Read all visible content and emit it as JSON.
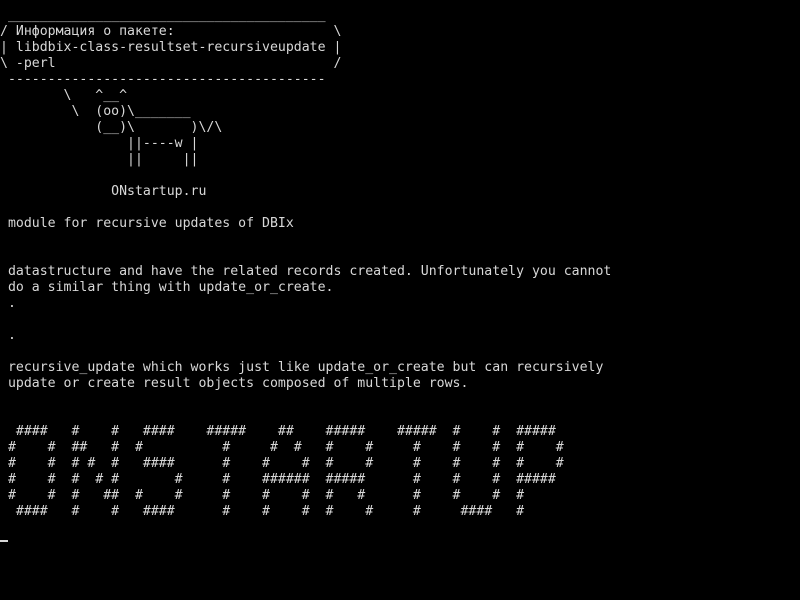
{
  "terminal": {
    "lines": [
      " ________________________________________",
      "/ Информация о пакете:                    \\",
      "| libdbix-class-resultset-recursiveupdate |",
      "\\ -perl                                   /",
      " ----------------------------------------",
      "        \\   ^__^",
      "         \\  (oo)\\_______",
      "            (__)\\       )\\/\\",
      "                ||----w |",
      "                ||     ||",
      "",
      "              ONstartup.ru",
      "",
      " module for recursive updates of DBIx",
      "",
      "",
      " datastructure and have the related records created. Unfortunately you cannot",
      " do a similar thing with update_or_create.",
      " .",
      "",
      " .",
      "",
      " recursive_update which works just like update_or_create but can recursively",
      " update or create result objects composed of multiple rows.",
      "",
      "",
      "  ####   #    #   ####    #####    ##    #####    #####  #    #  #####",
      " #    #  ##   #  #          #     #  #   #    #     #    #    #  #    #",
      " #    #  # #  #   ####      #    #    #  #    #     #    #    #  #    #",
      " #    #  #  # #       #     #    ######  #####      #    #    #  #####",
      " #    #  #   ##  #    #     #    #    #  #   #      #    #    #  #",
      "  ####   #    #   ####      #    #    #  #    #     #     ####   #"
    ],
    "foreground_color": "#d8d8d8",
    "background_color": "#000000"
  }
}
